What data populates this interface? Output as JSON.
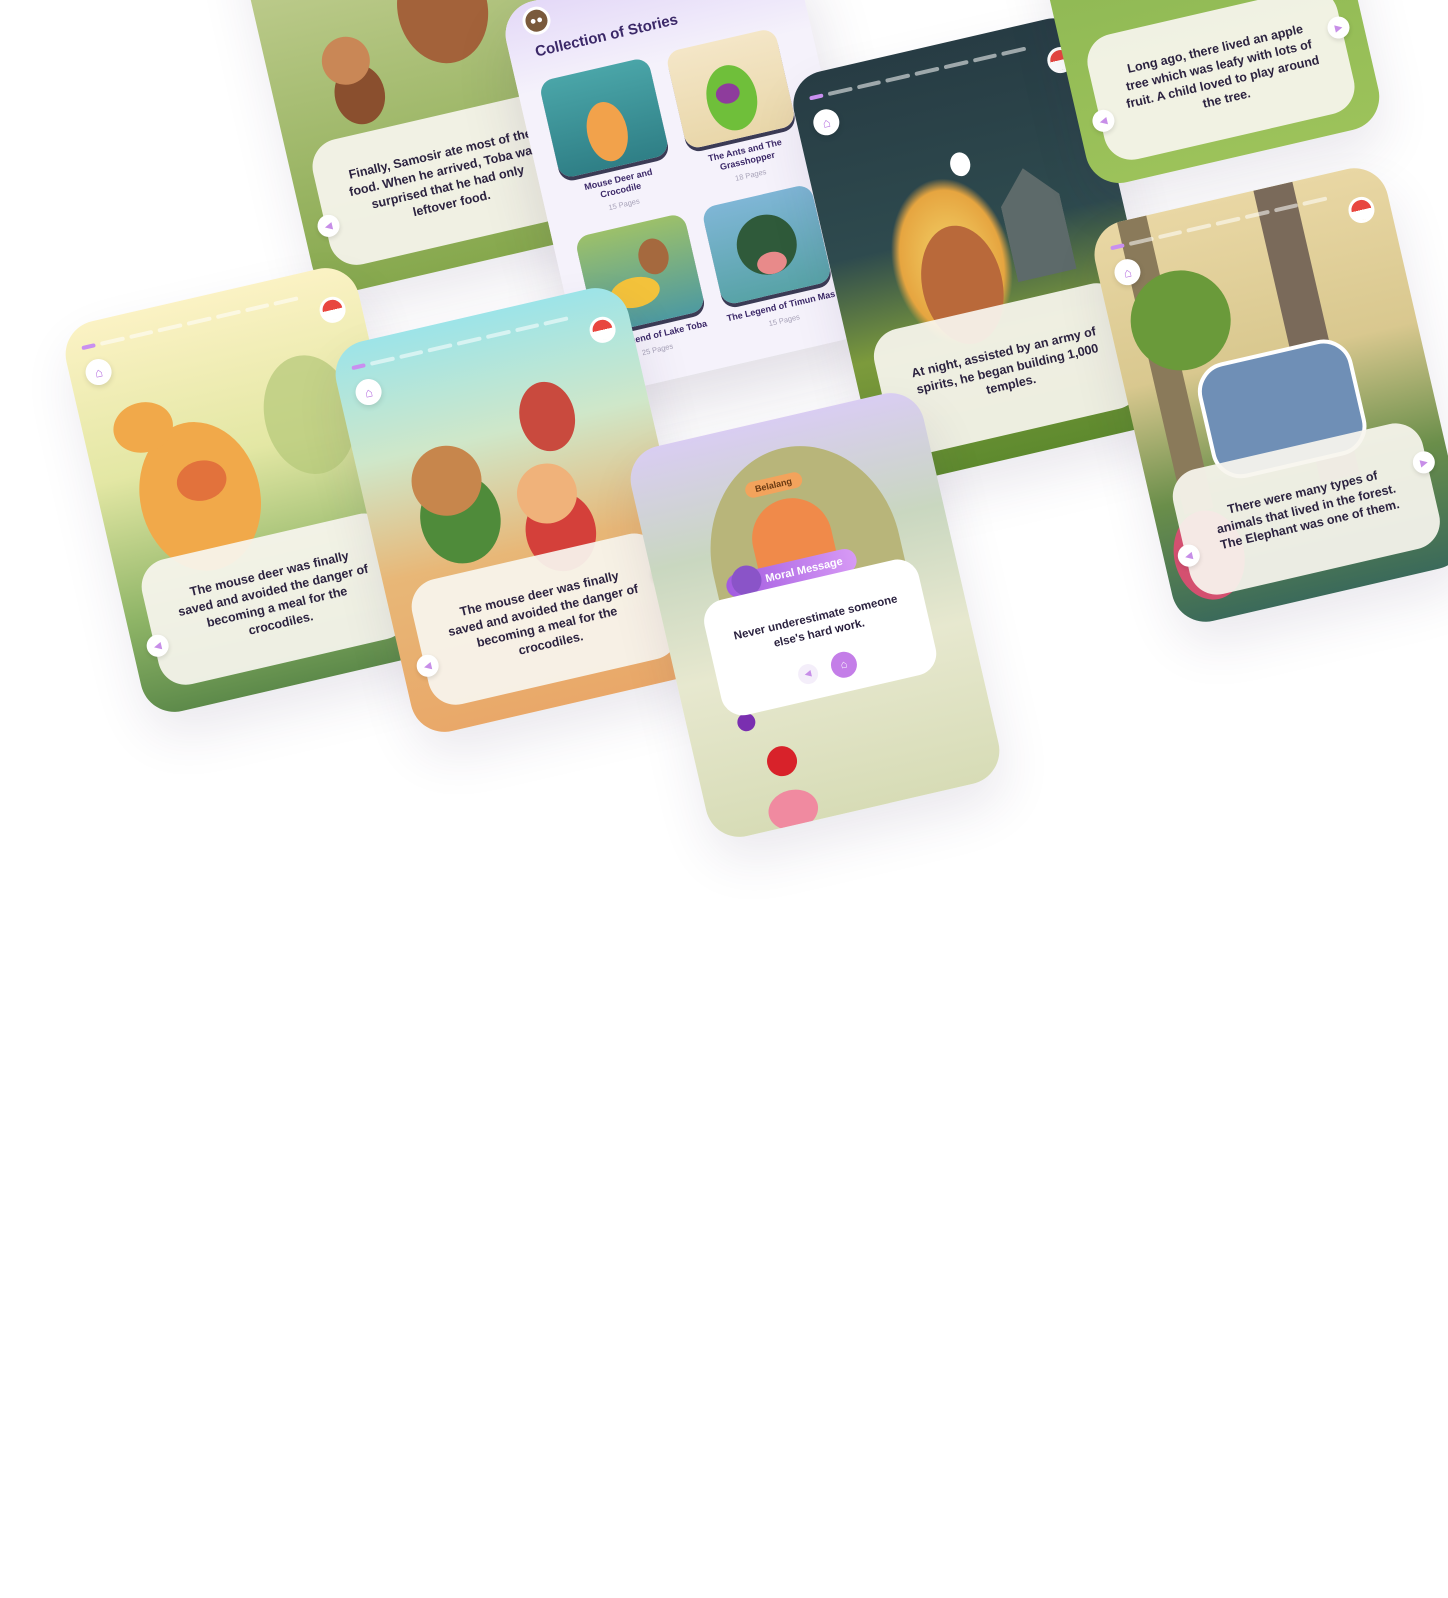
{
  "screens": {
    "samosir": {
      "text": "Finally, Samosir ate most of the food. When he arrived, Toba was surprised that he had only leftover food."
    },
    "library": {
      "title": "Collection of Stories",
      "books": [
        {
          "title": "Mouse Deer and Crocodile",
          "pages": "15 Pages"
        },
        {
          "title": "The Ants and The Grasshopper",
          "pages": "18 Pages"
        },
        {
          "title": "The Legend of Lake Toba",
          "pages": "25 Pages"
        },
        {
          "title": "The Legend of Timun Mas",
          "pages": "15 Pages"
        }
      ]
    },
    "temples": {
      "text": "At night, assisted by an army of spirits, he began building 1,000 temples."
    },
    "apple_tree": {
      "text": "Long ago, there lived an apple tree which was leafy with lots of fruit. A child loved to play around the tree."
    },
    "deer_saved": {
      "text": "The mouse deer was finally saved and avoided the danger of becoming a meal for the crocodiles."
    },
    "kids_saved": {
      "text": "The mouse deer was finally saved and avoided the danger of becoming a meal for the crocodiles."
    },
    "moral": {
      "badge": "Moral Message",
      "sign": "Belalang",
      "text": "Never underestimate someone else's hard work."
    },
    "elephant": {
      "text": "There were many types of animals that lived in the forest. The Elephant was one of them."
    }
  },
  "icons": {
    "home": "home-icon",
    "sound": "speaker-icon",
    "flag": "indonesia-flag-icon",
    "owl": "owl-icon"
  },
  "colors": {
    "accent": "#c47ee8",
    "text": "#2c2340",
    "title": "#3b2868"
  }
}
